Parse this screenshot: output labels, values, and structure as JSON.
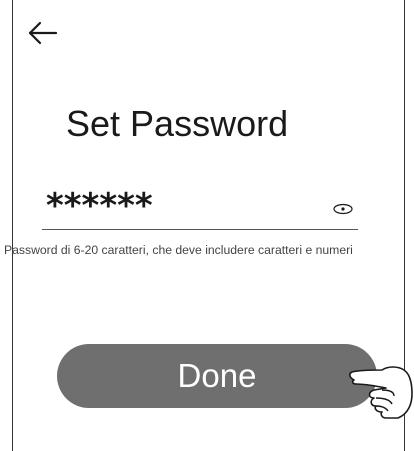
{
  "header": {
    "back_icon": "arrow-left-icon"
  },
  "main": {
    "title": "Set Password",
    "password": {
      "value": "******",
      "toggle_icon": "eye-icon"
    },
    "hint": "Password di 6-20 caratteri, che deve includere caratteri e numeri",
    "done_label": "Done",
    "pointer_icon": "pointing-hand-icon"
  },
  "colors": {
    "button_bg": "#6f6f6f",
    "button_text": "#ffffff",
    "text": "#1a1a1a"
  }
}
